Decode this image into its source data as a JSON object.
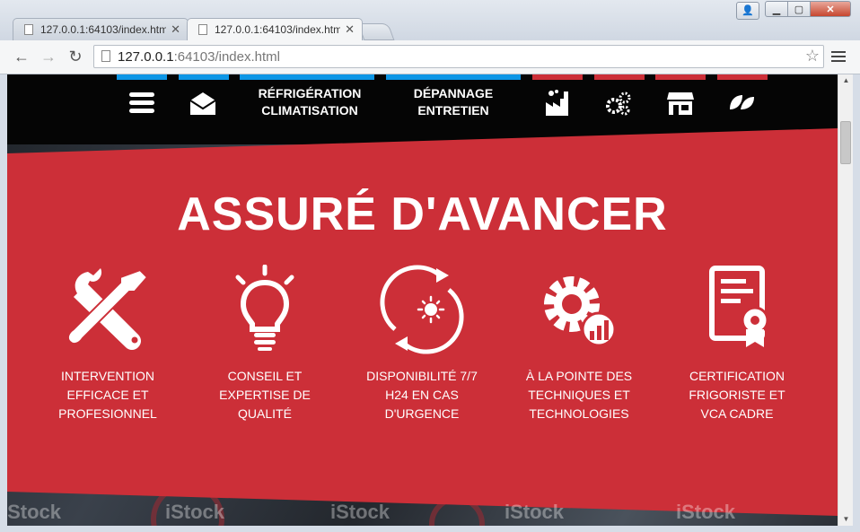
{
  "browser": {
    "tabs": [
      {
        "label": "127.0.0.1:64103/index.htm",
        "active": false
      },
      {
        "label": "127.0.0.1:64103/index.htm",
        "active": true
      }
    ],
    "url_host": "127.0.0.1",
    "url_rest": ":64103/index.html"
  },
  "site": {
    "nav": {
      "item_refrigeration_line1": "RÉFRIGÉRATION",
      "item_refrigeration_line2": "CLIMATISATION",
      "item_depannage_line1": "DÉPANNAGE",
      "item_depannage_line2": "ENTRETIEN"
    },
    "headline": "ASSURÉ D'AVANCER",
    "features": [
      {
        "lines": [
          "INTERVENTION",
          "EFFICACE ET",
          "PROFESIONNEL"
        ],
        "icon": "tools-icon"
      },
      {
        "lines": [
          "CONSEIL ET",
          "EXPERTISE DE",
          "QUALITÉ"
        ],
        "icon": "lightbulb-icon"
      },
      {
        "lines": [
          "DISPONIBILITÉ 7/7",
          "H24 EN CAS",
          "D'URGENCE"
        ],
        "icon": "day-night-icon"
      },
      {
        "lines": [
          "À LA POINTE DES",
          "TECHNIQUES ET",
          "TECHNOLOGIES"
        ],
        "icon": "gear-chart-icon"
      },
      {
        "lines": [
          "CERTIFICATION",
          "FRIGORISTE ET",
          "VCA CADRE"
        ],
        "icon": "certificate-icon"
      }
    ],
    "watermarks": [
      "iStock",
      "iStock",
      "iStock",
      "iStock",
      "iStock"
    ],
    "colors": {
      "red": "#cc2f38",
      "blue": "#0d96e6",
      "black": "#050505"
    }
  }
}
